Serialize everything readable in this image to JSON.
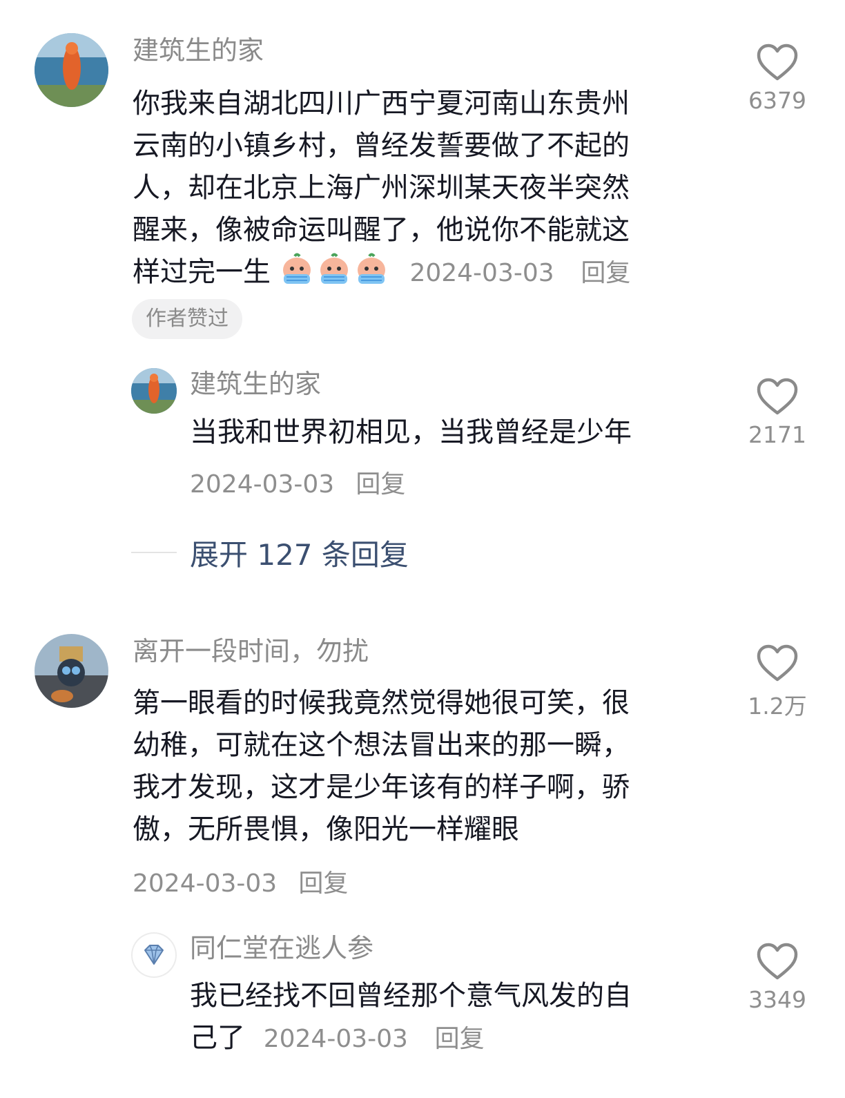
{
  "comments": [
    {
      "username": "建筑生的家",
      "text_lines": [
        "你我来自湖北四川广西宁夏河南山东贵州",
        "云南的小镇乡村，曾经发誓要做了不起的",
        "人，却在北京上海广州深圳某天夜半突然",
        "醒来，像被命运叫醒了，他说你不能就这",
        "样过完一生"
      ],
      "emoji_name": "crying-emoji",
      "date": "2024-03-03",
      "reply_label": "回复",
      "badge": "作者赞过",
      "likes": "6379",
      "sub_reply": {
        "username": "建筑生的家",
        "text": "当我和世界初相见，当我曾经是少年",
        "date": "2024-03-03",
        "reply_label": "回复",
        "likes": "2171"
      },
      "expand_label": "展开 127 条回复"
    },
    {
      "username": "离开一段时间，勿扰",
      "text_lines": [
        "第一眼看的时候我竟然觉得她很可笑，很",
        "幼稚，可就在这个想法冒出来的那一瞬，",
        "我才发现，这才是少年该有的样子啊，骄",
        "傲，无所畏惧，像阳光一样耀眼"
      ],
      "date": "2024-03-03",
      "reply_label": "回复",
      "likes": "1.2万",
      "sub_reply": {
        "username": "同仁堂在逃人参",
        "text_lines": [
          "我已经找不回曾经那个意气风发的自",
          "己了"
        ],
        "date": "2024-03-03",
        "reply_label": "回复",
        "likes": "3349"
      }
    }
  ],
  "colors": {
    "username": "#8a8a8a",
    "body": "#161823",
    "meta": "#8e8e8e",
    "expand": "#3b4f70",
    "badge_bg": "#f1f1f2"
  },
  "icons": {
    "like": "heart-outline-icon",
    "diamond": "diamond-icon"
  }
}
